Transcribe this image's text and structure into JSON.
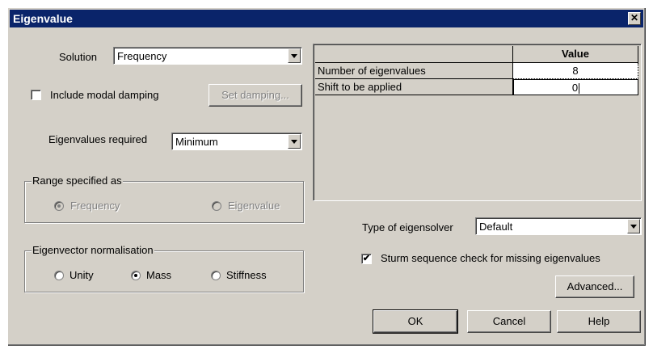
{
  "window": {
    "title": "Eigenvalue",
    "close_glyph": "✕"
  },
  "solution": {
    "label": "Solution",
    "value": "Frequency"
  },
  "modal_damping": {
    "label": "Include modal damping",
    "checked": false,
    "button_label": "Set damping..."
  },
  "eigen_required": {
    "label": "Eigenvalues required",
    "value": "Minimum"
  },
  "range": {
    "title": "Range specified as",
    "options": [
      "Frequency",
      "Eigenvalue"
    ],
    "selected": "Frequency",
    "enabled": false
  },
  "normalisation": {
    "title": "Eigenvector normalisation",
    "options": [
      "Unity",
      "Mass",
      "Stiffness"
    ],
    "selected": "Mass"
  },
  "table": {
    "header": "Value",
    "rows": [
      {
        "name": "Number of eigenvalues",
        "value": "8"
      },
      {
        "name": "Shift to be applied",
        "value": "0"
      }
    ]
  },
  "solver": {
    "label": "Type of eigensolver",
    "value": "Default"
  },
  "sturm": {
    "label": "Sturm sequence check for missing eigenvalues",
    "checked": true,
    "check_glyph": "✔"
  },
  "buttons": {
    "advanced": "Advanced...",
    "ok": "OK",
    "cancel": "Cancel",
    "help": "Help"
  }
}
